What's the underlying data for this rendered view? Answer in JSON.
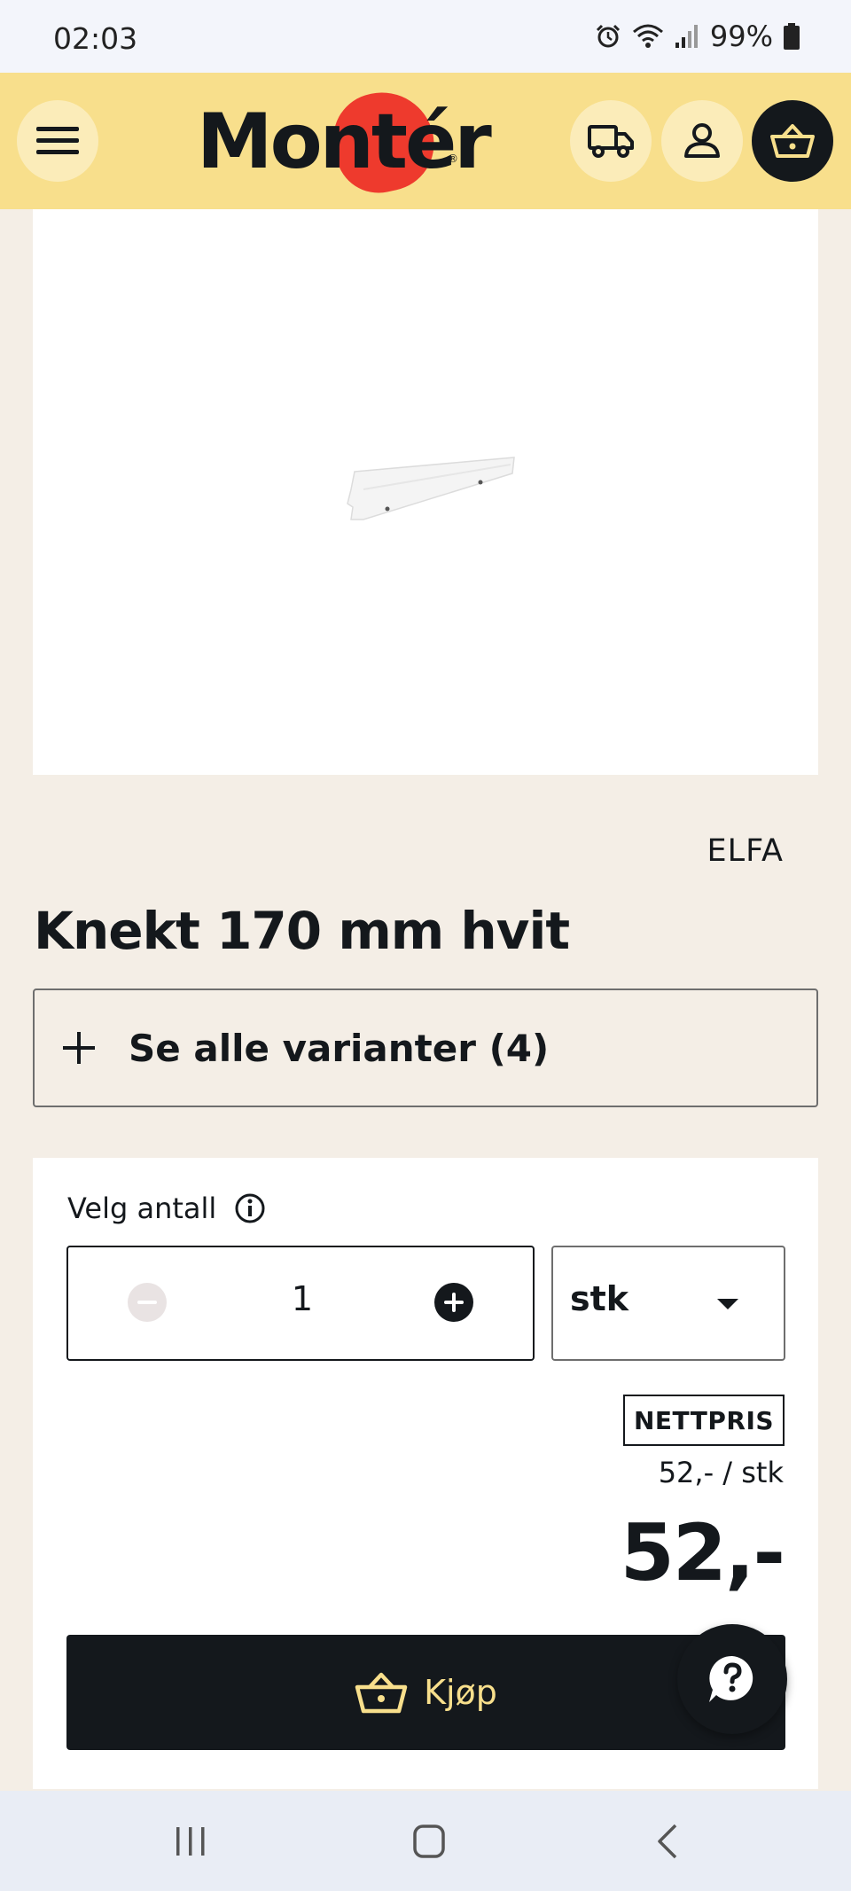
{
  "status_bar": {
    "time": "02:03",
    "battery": "99%",
    "icons": [
      "alarm-icon",
      "wifi-icon",
      "signal-icon",
      "battery-icon"
    ]
  },
  "header": {
    "logo": "Montér",
    "icons": [
      "menu-icon",
      "truck-icon",
      "user-icon",
      "basket-icon"
    ],
    "colors": {
      "background": "#f8df8c",
      "logo_accent": "#ee3a2d",
      "dark": "#14181c"
    }
  },
  "product": {
    "brand": "ELFA",
    "title": "Knekt 170 mm hvit",
    "variants_label": "Se alle varianter (4)"
  },
  "purchase": {
    "quantity_label": "Velg antall",
    "quantity": "1",
    "unit": "stk",
    "badge": "NETTPRIS",
    "unit_price": "52,- / stk",
    "price": "52,-",
    "buy_label": "Kjøp"
  },
  "nav": {
    "icons": [
      "recent-apps-icon",
      "home-icon",
      "back-icon"
    ]
  }
}
